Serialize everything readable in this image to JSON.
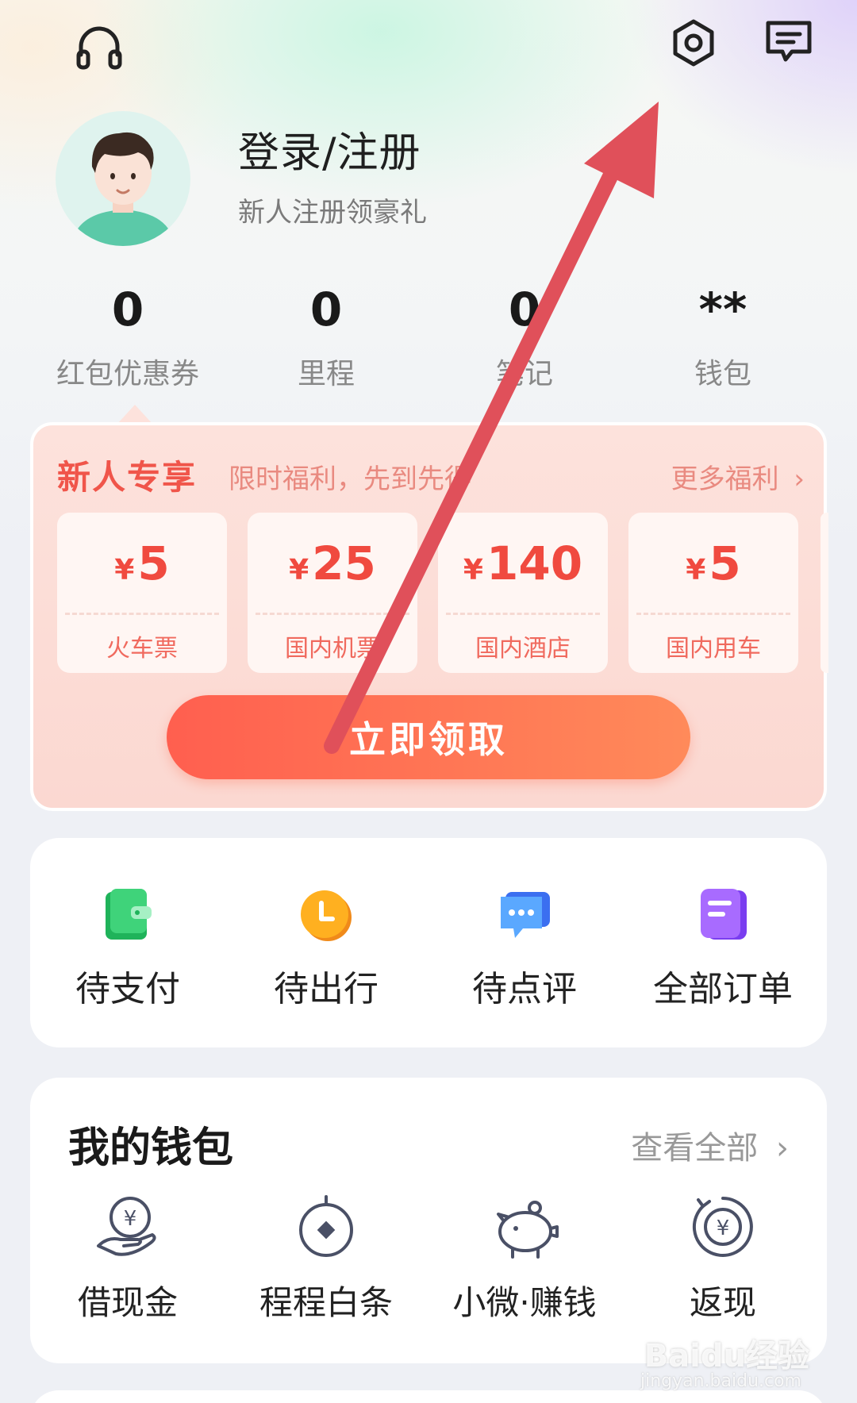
{
  "header": {
    "icons": [
      "headset-icon",
      "settings-icon",
      "message-icon"
    ]
  },
  "profile": {
    "title": "登录/注册",
    "subtitle": "新人注册领豪礼"
  },
  "stats": [
    {
      "value": "0",
      "label": "红包优惠券"
    },
    {
      "value": "0",
      "label": "里程"
    },
    {
      "value": "0",
      "label": "笔记"
    },
    {
      "value": "**",
      "label": "钱包"
    }
  ],
  "promo": {
    "title": "新人专享",
    "subtitle": "限时福利，先到先得",
    "more": "更多福利",
    "coupons": [
      {
        "currency": "¥",
        "amount": "5",
        "label": "火车票"
      },
      {
        "currency": "¥",
        "amount": "25",
        "label": "国内机票"
      },
      {
        "currency": "¥",
        "amount": "140",
        "label": "国内酒店"
      },
      {
        "currency": "¥",
        "amount": "5",
        "label": "国内用车"
      }
    ],
    "button": "立即领取",
    "colors": {
      "accent": "#f0554a",
      "button_start": "#ff5f4f",
      "button_end": "#ff8a5a"
    }
  },
  "orders": [
    {
      "label": "待支付",
      "icon": "wallet-green-icon"
    },
    {
      "label": "待出行",
      "icon": "clock-orange-icon"
    },
    {
      "label": "待点评",
      "icon": "chat-blue-icon"
    },
    {
      "label": "全部订单",
      "icon": "document-purple-icon"
    }
  ],
  "wallet": {
    "title": "我的钱包",
    "more": "查看全部",
    "items": [
      {
        "label": "借现金",
        "icon": "cash-hand-icon"
      },
      {
        "label": "程程白条",
        "icon": "credit-circle-icon"
      },
      {
        "label": "小微·赚钱",
        "icon": "piggy-bank-icon"
      },
      {
        "label": "返现",
        "icon": "cashback-icon"
      }
    ]
  },
  "watermark": {
    "text": "Baidu经验",
    "url": "jingyan.baidu.com"
  }
}
